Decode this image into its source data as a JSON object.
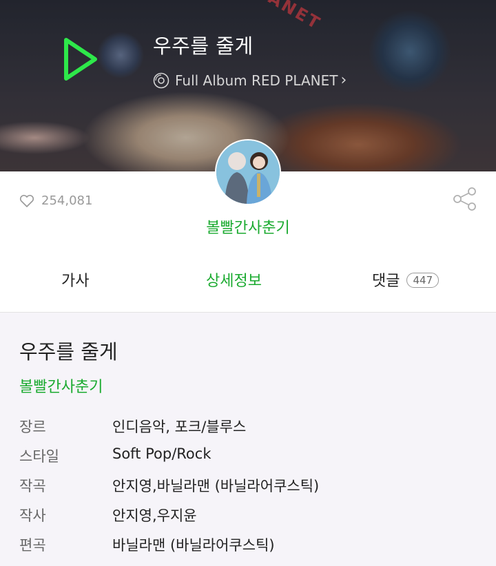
{
  "header": {
    "song_title": "우주를 줄게",
    "album_label": "Full Album RED PLANET",
    "background_word": "PLANET"
  },
  "stats": {
    "likes": "254,081"
  },
  "artist": {
    "name": "볼빨간사춘기"
  },
  "tabs": [
    {
      "label": "가사",
      "active": false
    },
    {
      "label": "상세정보",
      "active": true
    },
    {
      "label": "댓글",
      "count": "447",
      "active": false
    }
  ],
  "details": {
    "title": "우주를 줄게",
    "artist": "볼빨간사춘기",
    "rows": [
      {
        "key": "장르",
        "value": "인디음악, 포크/블루스"
      },
      {
        "key": "스타일",
        "value": "Soft Pop/Rock"
      },
      {
        "key": "작곡",
        "value": "안지영,바닐라맨 (바닐라어쿠스틱)"
      },
      {
        "key": "작사",
        "value": "안지영,우지윤"
      },
      {
        "key": "편곡",
        "value": "바닐라맨 (바닐라어쿠스틱)"
      }
    ]
  },
  "colors": {
    "accent": "#1aaa2f",
    "play_button": "#2ee84a"
  }
}
